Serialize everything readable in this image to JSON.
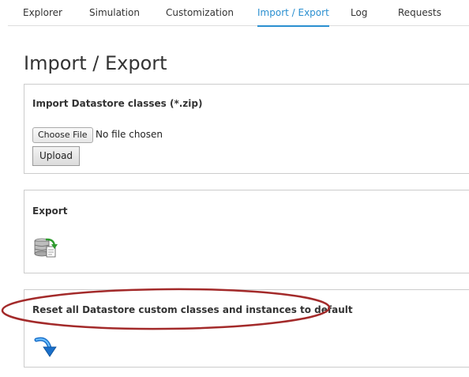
{
  "nav": {
    "tabs": [
      {
        "label": "Explorer",
        "active": false
      },
      {
        "label": "Simulation",
        "active": false
      },
      {
        "label": "Customization",
        "active": false
      },
      {
        "label": "Import / Export",
        "active": true
      },
      {
        "label": "Log",
        "active": false
      },
      {
        "label": "Requests",
        "active": false
      }
    ]
  },
  "page": {
    "title": "Import / Export"
  },
  "import_panel": {
    "title": "Import Datastore classes (*.zip)",
    "choose_file_label": "Choose File",
    "file_status": "No file chosen",
    "upload_label": "Upload"
  },
  "export_panel": {
    "title": "Export",
    "icon": "database-export-icon"
  },
  "reset_panel": {
    "title": "Reset all Datastore custom classes and instances to default",
    "icon": "curved-arrow-down-icon"
  },
  "colors": {
    "accent": "#2a8fd0",
    "annotation": "#a32a2a",
    "border": "#cccccc"
  }
}
